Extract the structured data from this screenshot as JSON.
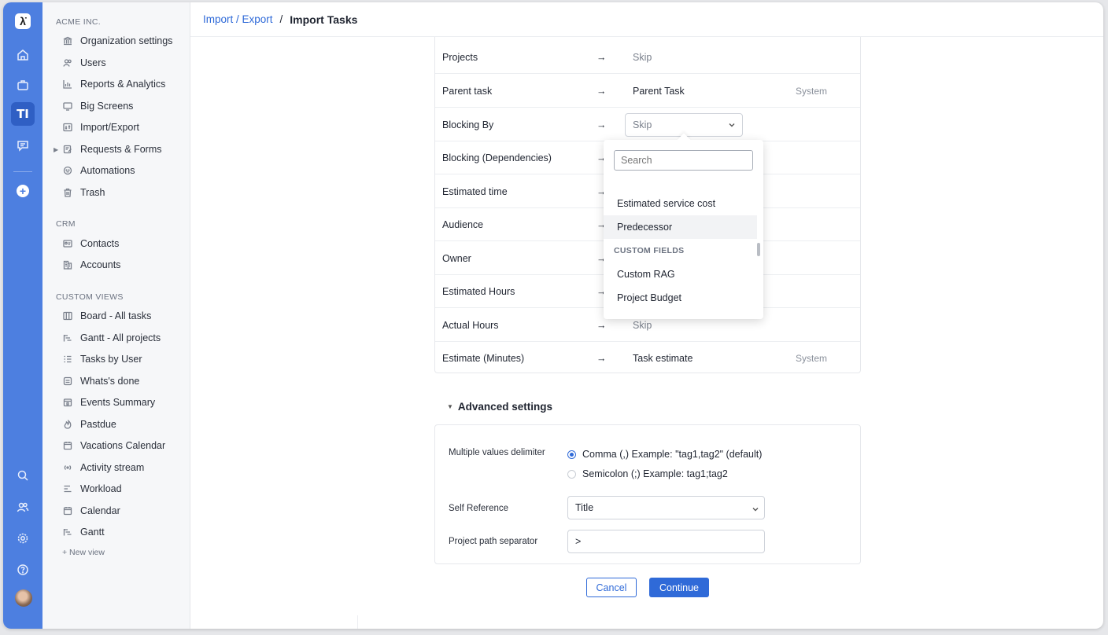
{
  "rail": {
    "icons": [
      "logo-icon",
      "home-icon",
      "briefcase-icon",
      "tasks-icon",
      "chat-icon",
      "add-icon",
      "search-icon",
      "people-icon",
      "settings-icon",
      "help-icon",
      "avatar"
    ],
    "logo_glyph": "λ̇",
    "active_glyph": "TI",
    "plus_glyph": "+",
    "color": "#4d7fe0"
  },
  "sidebar": {
    "org_title": "ACME INC.",
    "org_items": [
      {
        "label": "Organization settings",
        "icon": "bank-icon"
      },
      {
        "label": "Users",
        "icon": "users-icon"
      },
      {
        "label": "Reports & Analytics",
        "icon": "chart-icon"
      },
      {
        "label": "Big Screens",
        "icon": "tv-icon"
      },
      {
        "label": "Import/Export",
        "icon": "import-icon"
      },
      {
        "label": "Requests & Forms",
        "icon": "form-icon"
      },
      {
        "label": "Automations",
        "icon": "robot-icon"
      },
      {
        "label": "Trash",
        "icon": "trash-icon"
      }
    ],
    "crm_title": "CRM",
    "crm_items": [
      {
        "label": "Contacts",
        "icon": "contact-card-icon"
      },
      {
        "label": "Accounts",
        "icon": "building-icon"
      }
    ],
    "views_title": "CUSTOM VIEWS",
    "view_items": [
      {
        "label": "Board - All tasks",
        "icon": "board-icon"
      },
      {
        "label": "Gantt - All projects",
        "icon": "gantt-icon"
      },
      {
        "label": "Tasks by User",
        "icon": "list-icon"
      },
      {
        "label": "Whats's done",
        "icon": "doc-icon"
      },
      {
        "label": "Events Summary",
        "icon": "events-icon"
      },
      {
        "label": "Pastdue",
        "icon": "fire-icon"
      },
      {
        "label": "Vacations Calendar",
        "icon": "calendar-icon"
      },
      {
        "label": "Activity stream",
        "icon": "broadcast-icon"
      },
      {
        "label": "Workload",
        "icon": "workload-icon"
      },
      {
        "label": "Calendar",
        "icon": "calendar-icon"
      },
      {
        "label": "Gantt",
        "icon": "gantt-icon"
      }
    ],
    "new_view": "+  New view"
  },
  "header": {
    "crumb_link": "Import / Export",
    "crumb_sep": "/",
    "title": "Import Tasks"
  },
  "mapping": {
    "arrow": "→",
    "rows": [
      {
        "source": "Projects",
        "target": "Skip",
        "tag": ""
      },
      {
        "source": "Parent task",
        "target": "Parent Task",
        "tag": "System"
      },
      {
        "source": "Blocking By",
        "target": "Skip",
        "tag": ""
      },
      {
        "source": "Blocking (Dependencies)",
        "target": "",
        "tag": ""
      },
      {
        "source": "Estimated time",
        "target": "",
        "tag": ""
      },
      {
        "source": "Audience",
        "target": "",
        "tag": ""
      },
      {
        "source": "Owner",
        "target": "",
        "tag": ""
      },
      {
        "source": "Estimated Hours",
        "target": "",
        "tag": ""
      },
      {
        "source": "Actual Hours",
        "target": "Skip",
        "tag": ""
      },
      {
        "source": "Estimate (Minutes)",
        "target": "Task estimate",
        "tag": "System"
      }
    ]
  },
  "dropdown": {
    "search_placeholder": "Search",
    "items_before": [
      "Estimated service cost",
      "Predecessor"
    ],
    "group_title": "CUSTOM FIELDS",
    "items_after": [
      "Custom RAG",
      "Project Budget"
    ]
  },
  "advanced": {
    "title": "Advanced settings",
    "delimiter_label": "Multiple values delimiter",
    "option_comma": "Comma (,) Example: \"tag1,tag2\" (default)",
    "option_semicolon": "Semicolon (;) Example: tag1;tag2",
    "self_ref_label": "Self Reference",
    "self_ref_value": "Title",
    "path_sep_label": "Project path separator",
    "path_sep_value": ">"
  },
  "buttons": {
    "cancel": "Cancel",
    "continue": "Continue",
    "accent": "#2f6ad8"
  }
}
